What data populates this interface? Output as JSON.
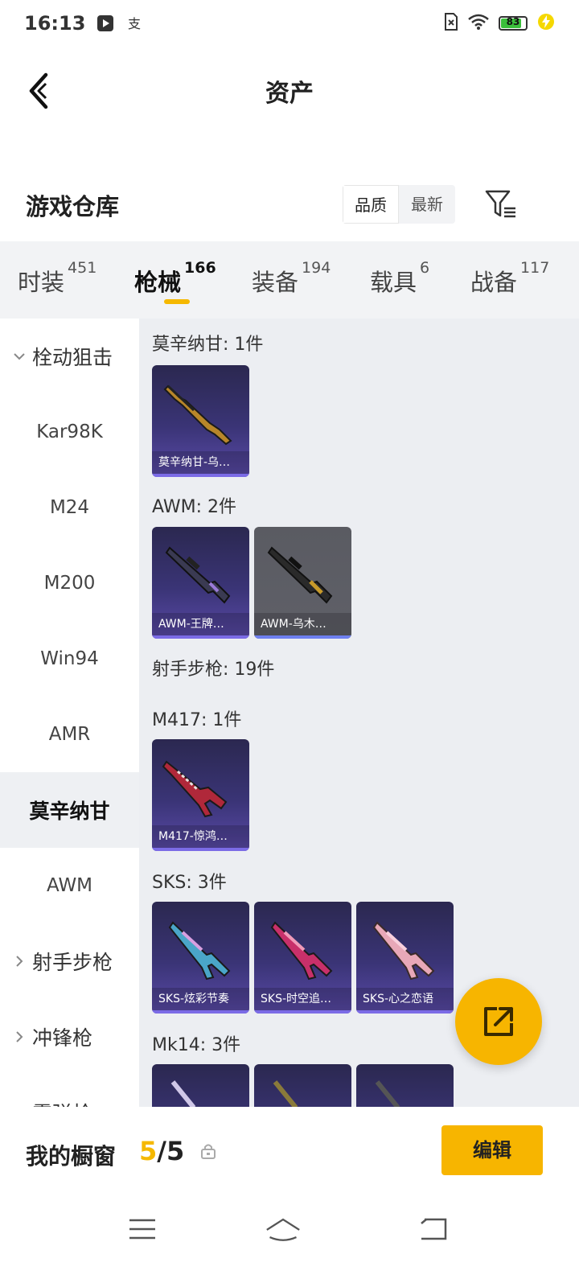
{
  "status_bar": {
    "time": "16:13",
    "battery": "83",
    "icons": [
      "media-play-icon",
      "alipay-icon",
      "sim-icon",
      "wifi-icon",
      "battery-icon",
      "charging-icon"
    ]
  },
  "header": {
    "title": "资产",
    "back_icon": "chevron-left-icon"
  },
  "warehouse": {
    "label": "游戏仓库",
    "sort_options": [
      "品质",
      "最新"
    ],
    "active_sort": "品质",
    "filter_icon": "filter-icon"
  },
  "tabs": [
    {
      "label": "时装",
      "count": "451"
    },
    {
      "label": "枪械",
      "count": "166",
      "active": true
    },
    {
      "label": "装备",
      "count": "194"
    },
    {
      "label": "载具",
      "count": "6"
    },
    {
      "label": "战备",
      "count": "117"
    }
  ],
  "sidebar": {
    "items": [
      {
        "label": "栓动狙击",
        "type": "group",
        "expanded": true
      },
      {
        "label": "Kar98K"
      },
      {
        "label": "M24"
      },
      {
        "label": "M200"
      },
      {
        "label": "Win94"
      },
      {
        "label": "AMR"
      },
      {
        "label": "莫辛纳甘",
        "selected": true
      },
      {
        "label": "AWM"
      },
      {
        "label": "射手步枪",
        "type": "group",
        "expanded": false
      },
      {
        "label": "冲锋枪",
        "type": "group",
        "expanded": false
      },
      {
        "label": "霰弹枪",
        "type": "group",
        "expanded": false
      }
    ]
  },
  "sections": [
    {
      "title": "莫辛纳甘: 1件",
      "items": [
        {
          "name": "莫辛纳甘-乌…",
          "style": "purple"
        }
      ]
    },
    {
      "title": "AWM: 2件",
      "items": [
        {
          "name": "AWM-王牌…",
          "style": "purple"
        },
        {
          "name": "AWM-乌木…",
          "style": "grey"
        }
      ]
    },
    {
      "title": "射手步枪: 19件",
      "items": []
    },
    {
      "title": "M417: 1件",
      "items": [
        {
          "name": "M417-惊鸿…",
          "style": "purple"
        }
      ]
    },
    {
      "title": "SKS: 3件",
      "items": [
        {
          "name": "SKS-炫彩节奏",
          "style": "purple"
        },
        {
          "name": "SKS-时空追…",
          "style": "purple"
        },
        {
          "name": "SKS-心之恋语",
          "style": "purple"
        }
      ]
    },
    {
      "title": "Mk14: 3件",
      "items": [
        {
          "name": "",
          "style": "purple"
        },
        {
          "name": "",
          "style": "purple"
        },
        {
          "name": "",
          "style": "purple"
        }
      ]
    }
  ],
  "fab": {
    "icon": "share-external-icon"
  },
  "showcase": {
    "label": "我的橱窗",
    "current": "5",
    "total": "/5",
    "lock_icon": "lock-icon",
    "edit_label": "编辑"
  },
  "nav": {
    "icons": [
      "menu-icon",
      "home-icon",
      "back-icon"
    ]
  },
  "colors": {
    "accent": "#f7b500",
    "card_purple": "#3a3476",
    "card_grey": "#5f6068",
    "panel_bg": "#eceef2"
  }
}
